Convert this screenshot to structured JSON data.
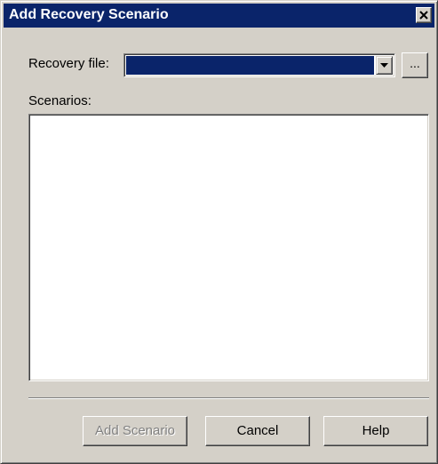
{
  "window": {
    "title": "Add Recovery Scenario",
    "close_icon": "close-icon",
    "titlebar_color": "#0a246a"
  },
  "recovery_file": {
    "label": "Recovery file:",
    "value": "",
    "dropdown_icon": "chevron-down-icon",
    "browse_label": "..."
  },
  "scenarios": {
    "label": "Scenarios:",
    "items": []
  },
  "buttons": {
    "add_scenario": "Add Scenario",
    "add_scenario_enabled": false,
    "cancel": "Cancel",
    "help": "Help"
  }
}
